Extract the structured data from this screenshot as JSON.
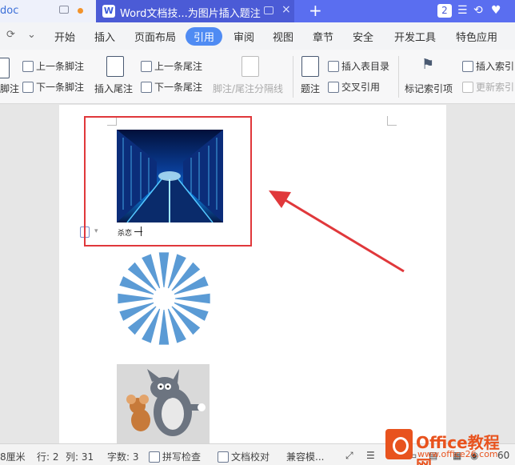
{
  "title_bar": {
    "tab1_label": "doc",
    "tab2_icon": "W",
    "tab2_label": "Word文档技...为图片插入题注",
    "window_badge": "2",
    "tab_close": "×",
    "new_tab": "+"
  },
  "quick_access": {
    "refresh": "⟳",
    "dropdown": "⌄"
  },
  "ribbon_tabs": [
    "开始",
    "插入",
    "页面布局",
    "引用",
    "审阅",
    "视图",
    "章节",
    "安全",
    "开发工具",
    "特色应用"
  ],
  "active_tab": "引用",
  "toolbar": {
    "footnote": "脚注",
    "prev_footnote": "上一条脚注",
    "next_footnote": "下一条脚注",
    "insert_endnote": "插入尾注",
    "prev_endnote": "上一条尾注",
    "next_endnote": "下一条尾注",
    "separator_line": "脚注/尾注分隔线",
    "caption": "题注",
    "insert_toc": "插入表目录",
    "cross_ref": "交叉引用",
    "mark_index": "标记索引项",
    "insert_index": "插入索引",
    "update_index": "更新索引"
  },
  "document": {
    "caption_text": "杀恋"
  },
  "status_bar": {
    "position": "8厘米",
    "row": "行: 2",
    "col": "列: 31",
    "word_count": "字数: 3",
    "spell_check": "拼写检查",
    "doc_check": "文档校对",
    "compat": "兼容模...",
    "zoom": "60"
  },
  "watermark": {
    "title": "Office教程网",
    "url": "www.office26.com"
  },
  "colors": {
    "accent": "#4f8bf3",
    "title_bar": "#5a6ef0",
    "highlight_box": "#e0383b"
  }
}
